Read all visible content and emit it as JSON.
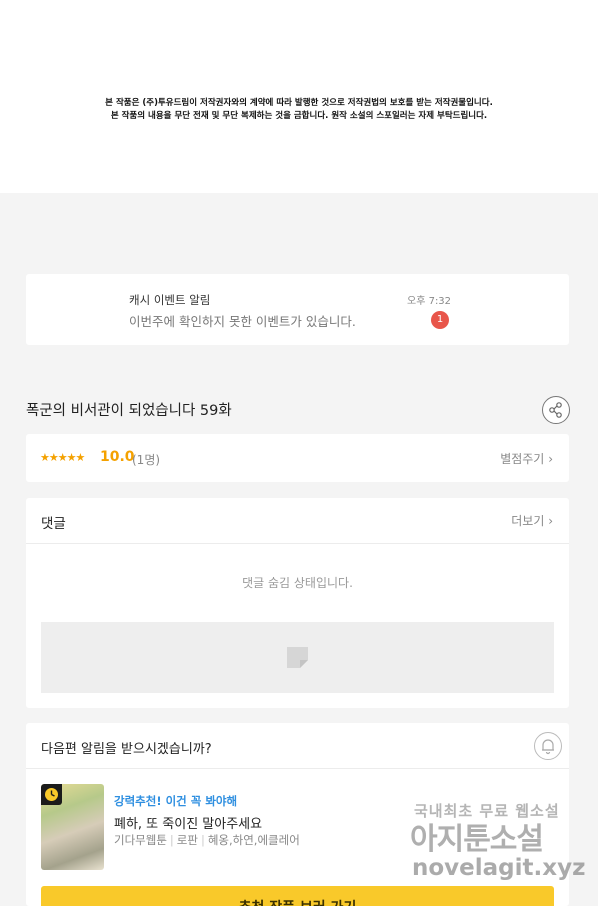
{
  "notice": {
    "line1": "본 작품은 (주)투유드림이 저작권자와의 계약에 따라 발행한 것으로 저작권법의 보호를 받는 저작권물입니다.",
    "line2": "본 작품의 내용을 무단 전재 및 무단 복제하는 것을 금합니다. 원작 소설의 스포일러는 자제 부탁드립니다."
  },
  "cash_event": {
    "title": "캐시 이벤트 알림",
    "message": "이번주에 확인하지 못한 이벤트가 있습니다.",
    "time": "오후 7:32",
    "badge": "1"
  },
  "episode": {
    "title": "폭군의 비서관이 되었습니다 59화",
    "share_icon": "share-icon"
  },
  "rating": {
    "stars": "★★★★★",
    "score": "10.0",
    "count": "(1명)",
    "rate_button": "별점주기"
  },
  "comments": {
    "title": "댓글",
    "more": "더보기",
    "hidden_message": "댓글 숨김 상태입니다.",
    "placeholder_icon": "comment-placeholder-icon"
  },
  "next_episode": {
    "question": "다음편 알림을 받으시겠습니까?",
    "bell_icon": "bell-icon"
  },
  "recommendation": {
    "label": "강력추천! 이건 꼭 봐야해",
    "title": "폐하, 또 죽이진 말아주세요",
    "genre": "기다무웹툰",
    "type": "로판",
    "authors": "혜옹,하연,에클레어",
    "button": "추천 작품 보러 가기"
  },
  "watermark": {
    "line1": "국내최초 무료 웹소설",
    "line2": "아지툰소설",
    "line3": "novelagit.xyz"
  },
  "colors": {
    "accent_orange": "#f4a100",
    "badge_red": "#e8554a",
    "link_blue": "#2f8fe0",
    "button_yellow": "#f9c92a"
  }
}
